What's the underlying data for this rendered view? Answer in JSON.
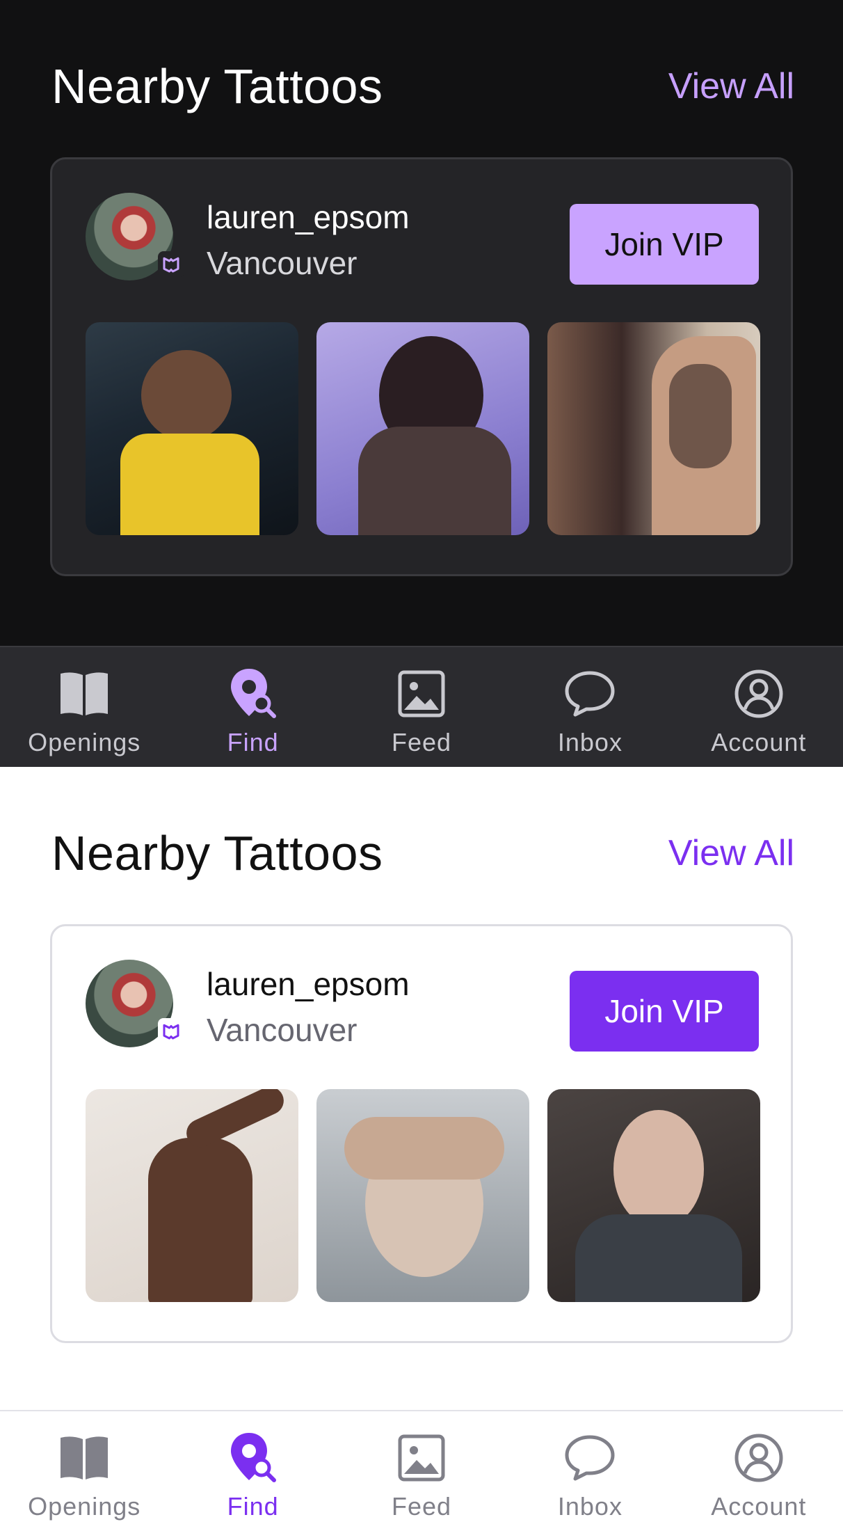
{
  "section": {
    "title": "Nearby Tattoos",
    "view_all": "View All"
  },
  "artist": {
    "username": "lauren_epsom",
    "city": "Vancouver"
  },
  "vip_button": {
    "label": "Join VIP"
  },
  "nav": {
    "tabs": [
      {
        "label": "Openings",
        "icon": "book-icon"
      },
      {
        "label": "Find",
        "icon": "map-pin-search-icon",
        "active": true
      },
      {
        "label": "Feed",
        "icon": "image-icon"
      },
      {
        "label": "Inbox",
        "icon": "chat-bubble-icon"
      },
      {
        "label": "Account",
        "icon": "user-circle-icon"
      }
    ]
  },
  "themes": {
    "dark": {
      "accent": "#c9a3ff",
      "background": "#111112",
      "card": "#242427",
      "tabbar": "#2b2b2f"
    },
    "light": {
      "accent": "#7b2ff0",
      "background": "#ffffff",
      "card": "#ffffff",
      "tabbar": "#ffffff"
    }
  }
}
